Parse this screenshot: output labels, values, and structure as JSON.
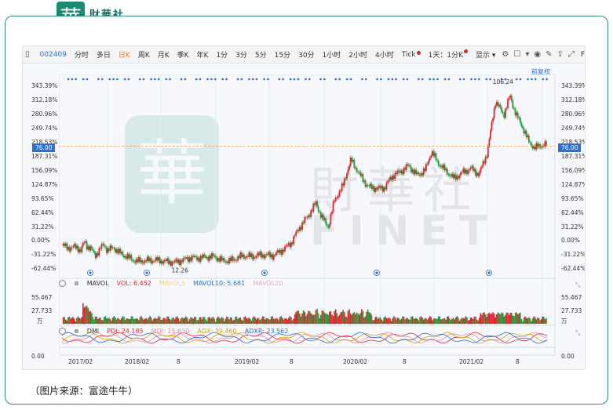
{
  "brand": {
    "mark": "華",
    "name_cn": "財華社",
    "name_en": "FINET"
  },
  "toolbar": {
    "code": "002409",
    "items": [
      {
        "label": "分时",
        "active": false
      },
      {
        "label": "多日",
        "active": false
      },
      {
        "label": "日K",
        "active": true
      },
      {
        "label": "周K",
        "active": false
      },
      {
        "label": "月K",
        "active": false
      },
      {
        "label": "季K",
        "active": false
      },
      {
        "label": "年K",
        "active": false
      },
      {
        "label": "1分",
        "active": false
      },
      {
        "label": "3分",
        "active": false
      },
      {
        "label": "5分",
        "active": false
      },
      {
        "label": "15分",
        "active": false
      },
      {
        "label": "30分",
        "active": false
      },
      {
        "label": "1小时",
        "active": false
      },
      {
        "label": "2小时",
        "active": false
      },
      {
        "label": "4小时",
        "active": false
      }
    ],
    "tick_label": "Tick",
    "period_label": "1天：1分K",
    "display_label": "显示",
    "fq_label": "F(X)",
    "icons": [
      "gear-icon",
      "square-icon",
      "dropdown-icon",
      "camera-icon",
      "pen-icon",
      "share-icon",
      "expand-icon",
      "formula-icon",
      "panel-icon"
    ]
  },
  "fuquan_label": "前复权",
  "main_axis": {
    "ticks": [
      "343.39%",
      "312.18%",
      "280.96%",
      "249.74%",
      "218.53%",
      "187.31%",
      "156.09%",
      "124.87%",
      "93.65%",
      "62.44%",
      "31.22%",
      "0.00%",
      "-31.22%",
      "-62.44%"
    ],
    "current_price": "76.00",
    "high_label": "106.24",
    "low_label": "12.26"
  },
  "mavol": {
    "name": "MAVOL",
    "vol_label": "VOL: 6.452",
    "ma5_label": "MAVOL5",
    "ma10_label": "MAVOL10: 5.681",
    "ma20_label": "MAVOL20",
    "ticks": [
      "55.467",
      "27.733",
      "万"
    ]
  },
  "dmi": {
    "name": "DMI",
    "pdi_label": "PDI: 24.185",
    "mdi_label": "MDI: 15.630",
    "adx_label": "ADX: 39.460",
    "adxr_label": "ADXR: 23.562",
    "ticks": [
      "0.00"
    ]
  },
  "x_axis": [
    "2017/02",
    "2018/02",
    "8",
    "2019/02",
    "8",
    "2020/02",
    "8",
    "2021/02",
    "8"
  ],
  "caption": "（图片来源：富途牛牛）",
  "colors": {
    "up": "#e2242d",
    "down": "#1f9b3c",
    "accent": "#2b6fd1",
    "active": "#ee7a18",
    "frame": "#2f8d7c"
  }
}
